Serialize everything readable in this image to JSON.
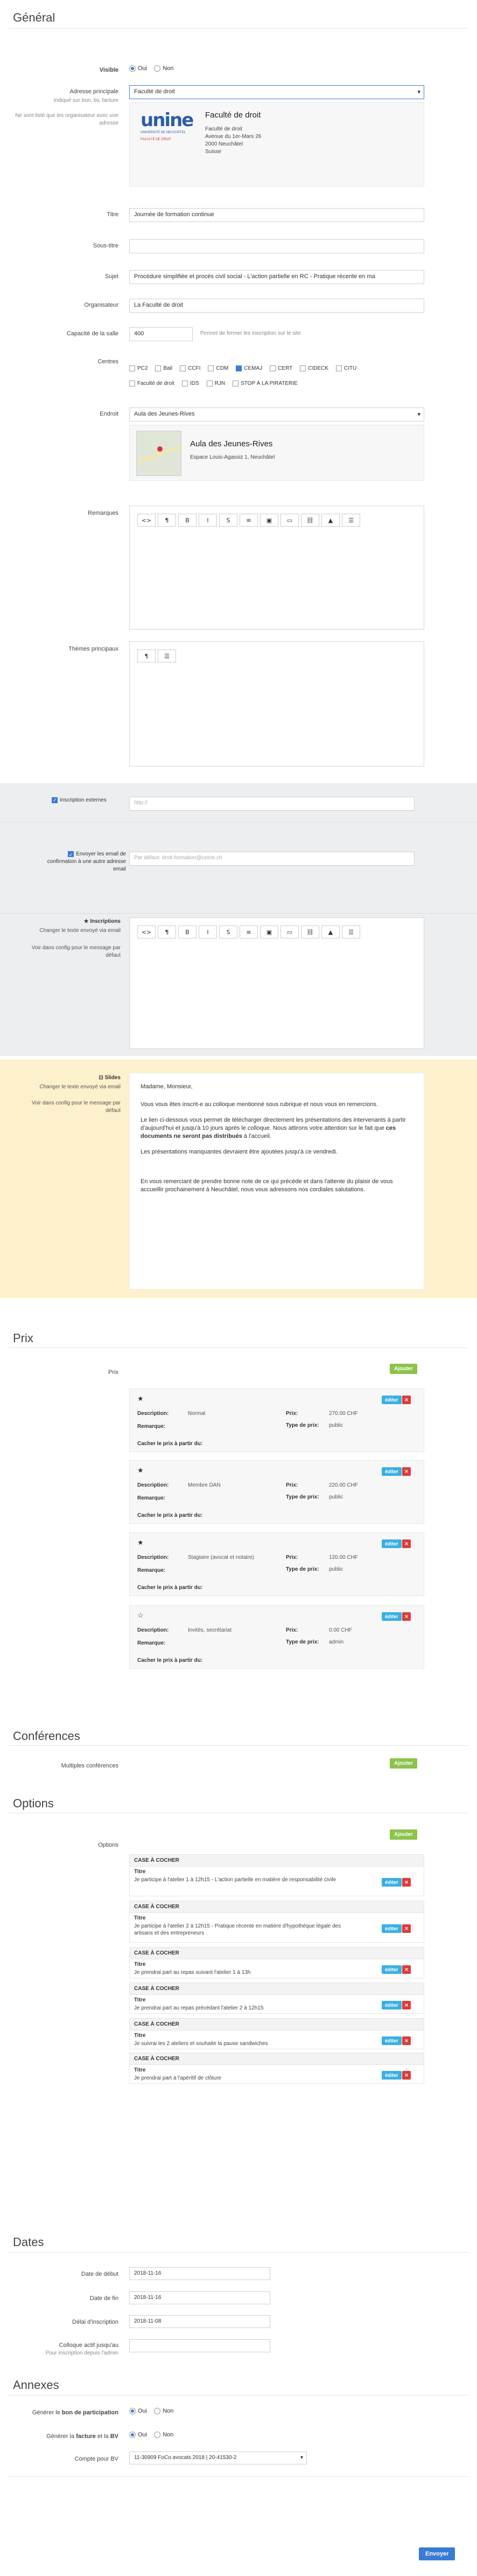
{
  "sections": {
    "general": "Général",
    "prix": "Prix",
    "conferences": "Conférences",
    "options": "Options",
    "dates": "Dates",
    "annexes": "Annexes"
  },
  "general": {
    "visible_label": "Visible",
    "yes": "Oui",
    "no": "Non",
    "adresse_label": "Adresse principale",
    "adresse_sub": "Indiqué sur bon, bv, facture",
    "adresse_note": "Ne sont listé que les organisateur avec une adresse",
    "adresse_value": "Faculté de droit",
    "org_title": "Faculté de droit",
    "org_lines": [
      "Faculté de droit",
      "Avenue du 1er-Mars 26",
      "2000 Neuchâtel",
      "Suisse"
    ],
    "logo_text": "unine",
    "logo_sub": "UNIVERSITÉ DE NEUCHÂTEL",
    "logo_tag": "FACULTÉ DE DROIT",
    "titre_label": "Titre",
    "titre_value": "Journée de formation continue",
    "soustitre_label": "Sous-titre",
    "soustitre_value": "",
    "sujet_label": "Sujet",
    "sujet_value": "Procédure simplifiée et procès civil social - L'action partielle en RC - Pratique récente en ma",
    "organisateur_label": "Organisateur",
    "organisateur_value": "La Faculté de droit",
    "capacite_label": "Capacité de la salle",
    "capacite_value": "400",
    "capacite_note": "Permet de fermer les inscription sur le site",
    "centres_label": "Centres",
    "centres": [
      {
        "n": "PC2",
        "on": false
      },
      {
        "n": "Bail",
        "on": false
      },
      {
        "n": "CCFI",
        "on": false
      },
      {
        "n": "CDM",
        "on": false
      },
      {
        "n": "CEMAJ",
        "on": true
      },
      {
        "n": "CERT",
        "on": false
      },
      {
        "n": "CIDECK",
        "on": false
      },
      {
        "n": "CITU",
        "on": false
      },
      {
        "n": "Faculté de droit",
        "on": false
      },
      {
        "n": "IDS",
        "on": false
      },
      {
        "n": "RJN",
        "on": false
      },
      {
        "n": "STOP À LA PIRATERIE",
        "on": false
      }
    ],
    "endroit_label": "Endroit",
    "endroit_value": "Aula des Jeunes-Rives",
    "endroit_title": "Aula des Jeunes-Rives",
    "endroit_addr": "Espace Louis-Agassiz 1, Neuchâtel",
    "remarques_label": "Remarques",
    "themes_label": "Thèmes principaux",
    "ext_label": "Inscription externes",
    "ext_placeholder": "http://",
    "email_label": "Envoyer les email de confirmation à une autre adresse email",
    "email_placeholder": "Par défaut: droit.formation@unine.ch",
    "insc_label": "Inscriptions",
    "insc_sub": "Changer le texte envoyé via email",
    "insc_sub2": "Voir dans config pour le message par défaut",
    "slides_label": "Slides",
    "slides_sub": "Changer le texte envoyé via email",
    "slides_sub2": "Voir dans config pour le message par défaut",
    "slides_text": [
      "Madame, Monsieur,",
      "Vous vous êtes inscrit-e au colloque mentionné sous rubrique et nous vous en remercions.",
      "Le lien ci-dessous vous permet de télécharger directement les présentations des intervenants à partir d'aujourd'hui et jusqu'à 10 jours après le colloque. Nous attirons votre attention sur le fait que ",
      "ces documents ne seront pas distribués",
      " à l'accueil.",
      "Les présentations manquantes devraient être ajoutées jusqu'à ce vendredi.",
      "En vous remerciant de prendre bonne note de ce qui précède et dans l'attente du plaisir de vous accueillir prochainement à Neuchâtel, nous vous adressons nos cordiales salutations."
    ]
  },
  "toolbar": [
    "<>",
    "¶",
    "B",
    "I",
    "S",
    "≡",
    "▣",
    "▭",
    "⛓",
    "▲",
    "☰"
  ],
  "prix": {
    "label": "Prix",
    "add": "Ajouter",
    "edit": "éditer",
    "del": "✕",
    "l_desc": "Description:",
    "l_rem": "Remarque:",
    "l_prix": "Prix:",
    "l_type": "Type de prix:",
    "hide": "Cacher le prix à partir du:",
    "items": [
      {
        "star": "★",
        "desc": "Normal",
        "prix": "270.00 CHF",
        "type": "public"
      },
      {
        "star": "★",
        "desc": "Membre DAN",
        "prix": "220.00 CHF",
        "type": "public"
      },
      {
        "star": "★",
        "desc": "Stagiaire (avocat et notaire)",
        "prix": "120.00 CHF",
        "type": "public"
      },
      {
        "star": "☆",
        "desc": "Invités, secrétariat",
        "prix": "0.00 CHF",
        "type": "admin"
      }
    ]
  },
  "conferences": {
    "label": "Multiples conférences",
    "add": "Ajouter"
  },
  "options": {
    "label": "Options",
    "add": "Ajouter",
    "header": "CASE À COCHER",
    "titre": "Titre",
    "items": [
      "Je participe à l'atelier 1 à 12h15 - L'action partielle en matière de responsabilité civile",
      "Je participe à l'atelier 2 à 12h15 - Pratique récente en matière d'hypothèque légale des artisans et des entrepreneurs",
      "Je prendrai part au repas suivant l'atelier 1 à 13h",
      "Je prendrai part au repas précédant l'atelier 2 à 12h15",
      "Je suivrai les 2 ateliers et souhaite la pause sandwiches",
      "Je prendrai part à l'apéritif de clôture"
    ]
  },
  "dates": {
    "debut_label": "Date de début",
    "debut": "2018-11-16",
    "fin_label": "Date de fin",
    "fin": "2018-11-16",
    "delai_label": "Délai d'inscription",
    "delai": "2018-11-08",
    "actif_label": "Colloque actif jusqu'au",
    "actif_sub": "Pour inscription depuis l'admin",
    "actif": ""
  },
  "annexes": {
    "bon_label_a": "Générer le ",
    "bon_label_b": "bon de participation",
    "fact_label_a": "Générer la ",
    "fact_label_b": "facture",
    " fact_label_c": " et la ",
    "fact_label_d": "BV",
    "compte_label": "Compte pour BV",
    "compte_value": "11-30909 FoCo avocats 2018 | 20-41530-2",
    "send": "Envoyer"
  }
}
